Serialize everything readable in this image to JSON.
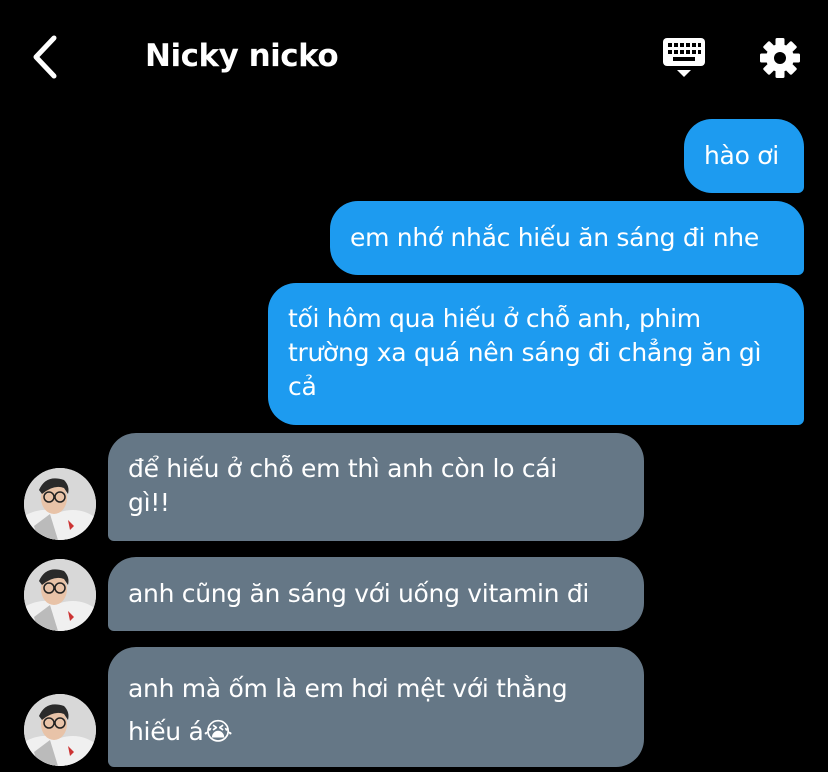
{
  "header": {
    "back_icon": "chevron-left-icon",
    "title": "Nicky nicko",
    "keyboard_icon": "keyboard-icon",
    "settings_icon": "gear-icon"
  },
  "colors": {
    "background": "#000000",
    "sent_bubble": "#1d9bf0",
    "received_bubble": "#657786",
    "text": "#ffffff"
  },
  "messages": [
    {
      "direction": "sent",
      "text": "hào ơi"
    },
    {
      "direction": "sent",
      "text": "em nhớ nhắc hiếu ăn sáng đi nhe"
    },
    {
      "direction": "sent",
      "text": "tối hôm qua hiếu ở chỗ anh, phim trường xa quá nên sáng đi chẳng ăn gì cả"
    },
    {
      "direction": "received",
      "text": "để hiếu ở chỗ em thì anh còn lo cái gì!!"
    },
    {
      "direction": "received",
      "text": "anh cũng ăn sáng với uống vitamin đi"
    },
    {
      "direction": "received",
      "text": "anh mà ốm là em hơi mệt với thằng hiếu á😭"
    }
  ]
}
